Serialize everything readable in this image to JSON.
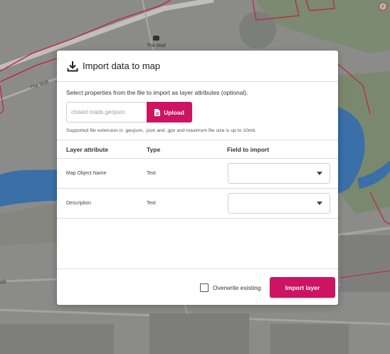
{
  "map": {
    "labels": [
      "The Mall",
      "The Mall",
      "alk"
    ]
  },
  "modal": {
    "title": "Import data to map",
    "icon": "download-icon",
    "instructions": "Select properties from the file to import as layer attributes (optional).",
    "file_input": {
      "value": "closed roads.geojson",
      "icon": "file-icon"
    },
    "upload_label": "Upload",
    "support_text": "Supported file extension is .geojson, .json and .gpx and maximum file size is up to 10mb.",
    "table": {
      "headers": [
        "Layer attribute",
        "Type",
        "Field to import"
      ],
      "rows": [
        {
          "attribute": "Map Object Name",
          "type": "Text",
          "field": ""
        },
        {
          "attribute": "Description",
          "type": "Text",
          "field": ""
        }
      ]
    },
    "overwrite_label": "Overwrite existing",
    "overwrite_checked": false,
    "import_label": "Import layer"
  },
  "colors": {
    "accent": "#cc1463",
    "river": "#3a6fa8",
    "road_outline": "#c2203f"
  }
}
